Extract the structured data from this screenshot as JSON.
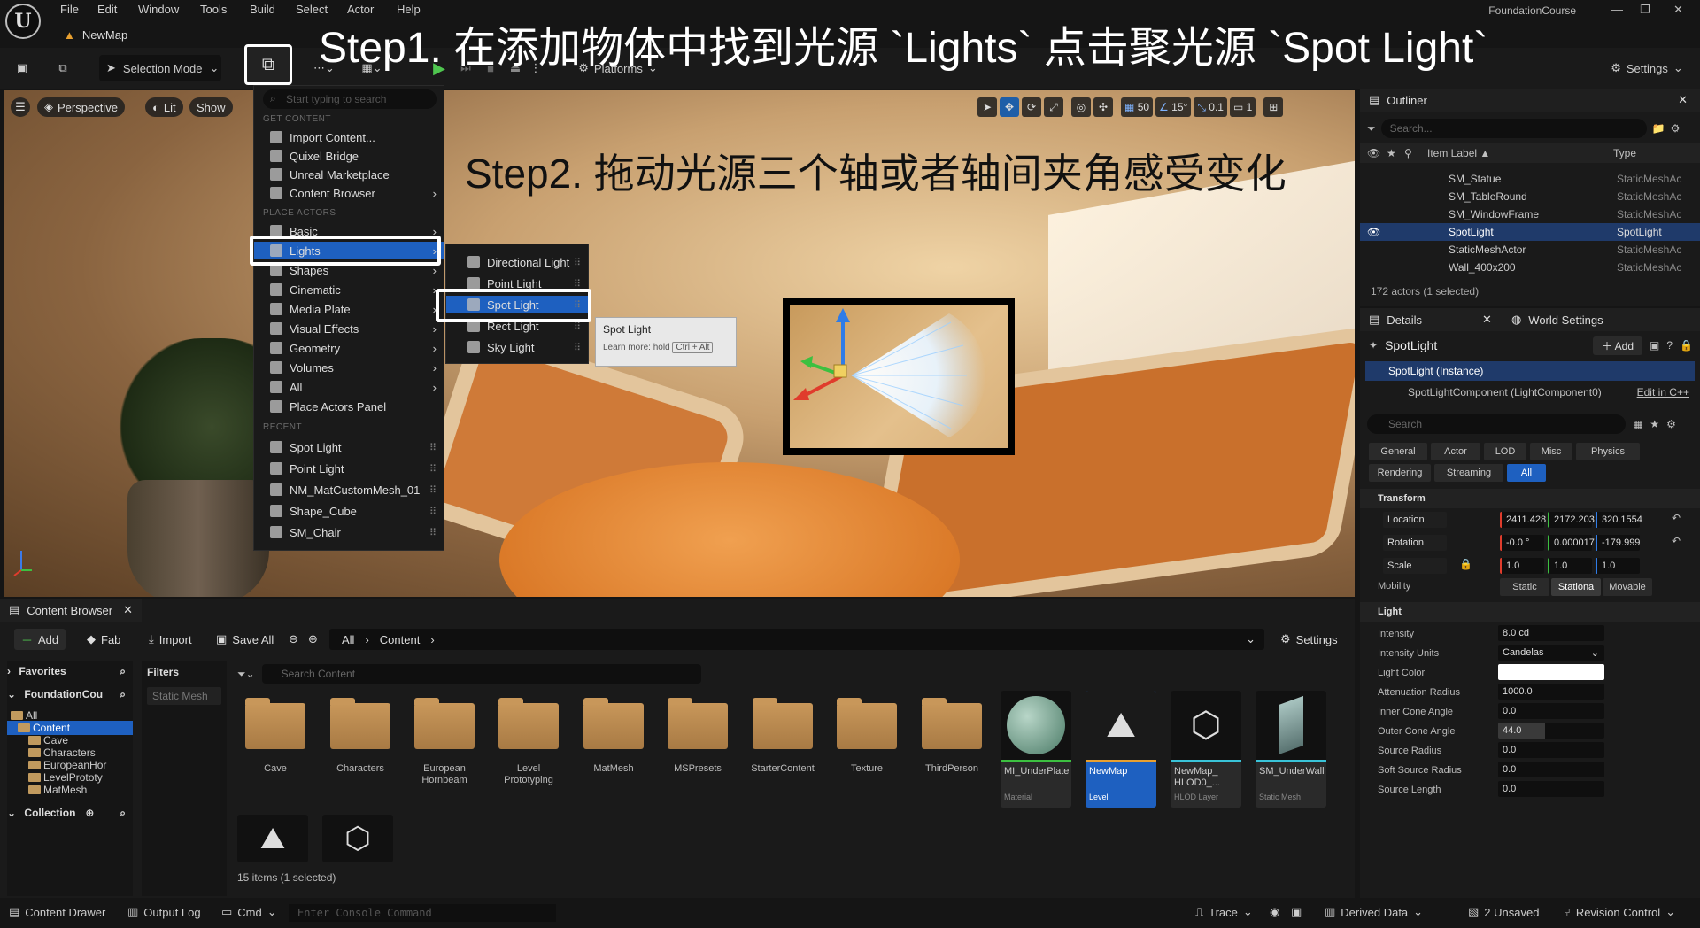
{
  "menubar": {
    "items": [
      "File",
      "Edit",
      "Window",
      "Tools",
      "Build",
      "Select",
      "Actor",
      "Help"
    ],
    "project": "FoundationCourse"
  },
  "map_tab": "NewMap",
  "toolbar": {
    "selection_mode": "Selection Mode",
    "platforms": "Platforms",
    "settings": "Settings"
  },
  "annotations": {
    "step1": "Step1. 在添加物体中找到光源 `Lights` 点击聚光源 `Spot Light`",
    "step2": "Step2. 拖动光源三个轴或者轴间夹角感受变化"
  },
  "viewport": {
    "perspective": "Perspective",
    "lit": "Lit",
    "show": "Show",
    "grid_size": "50",
    "angle": "15°",
    "scale": "0.1",
    "camera_speed": "1"
  },
  "add_menu": {
    "search_placeholder": "Start typing to search",
    "get_content_header": "GET CONTENT",
    "get_content": [
      "Import Content...",
      "Quixel Bridge",
      "Unreal Marketplace",
      "Content Browser"
    ],
    "place_actors_header": "PLACE ACTORS",
    "place_actors": [
      "Basic",
      "Lights",
      "Shapes",
      "Cinematic",
      "Media Plate",
      "Visual Effects",
      "Geometry",
      "Volumes",
      "All",
      "Place Actors Panel"
    ],
    "recent_header": "RECENT",
    "recent": [
      "Spot Light",
      "Point Light",
      "NM_MatCustomMesh_01",
      "Shape_Cube",
      "SM_Chair"
    ]
  },
  "lights_menu": [
    "Directional Light",
    "Point Light",
    "Spot Light",
    "Rect Light",
    "Sky Light"
  ],
  "tooltip": {
    "title": "Spot Light",
    "learn_more": "Learn more: hold",
    "shortcut": "Ctrl + Alt"
  },
  "outliner": {
    "title": "Outliner",
    "search_placeholder": "Search...",
    "col_label": "Item Label ▲",
    "col_type": "Type",
    "rows": [
      {
        "label": "SM_Statue",
        "type": "StaticMeshAc"
      },
      {
        "label": "SM_TableRound",
        "type": "StaticMeshAc"
      },
      {
        "label": "SM_WindowFrame",
        "type": "StaticMeshAc"
      },
      {
        "label": "SpotLight",
        "type": "SpotLight"
      },
      {
        "label": "StaticMeshActor",
        "type": "StaticMeshAc"
      },
      {
        "label": "Wall_400x200",
        "type": "StaticMeshAc"
      }
    ],
    "count": "172 actors (1 selected)"
  },
  "details": {
    "tab_details": "Details",
    "tab_world": "World Settings",
    "actor_name": "SpotLight",
    "add": "Add",
    "instance": "SpotLight (Instance)",
    "component": "SpotLightComponent (LightComponent0)",
    "edit_cpp": "Edit in C++",
    "search_placeholder": "Search",
    "filters": [
      "General",
      "Actor",
      "LOD",
      "Misc",
      "Physics",
      "Rendering",
      "Streaming",
      "All"
    ],
    "transform_header": "Transform",
    "location_label": "Location",
    "location": [
      "2411.428",
      "2172.203",
      "320.1554"
    ],
    "rotation_label": "Rotation",
    "rotation": [
      "-0.0 °",
      "0.000017",
      "-179.999"
    ],
    "scale_label": "Scale",
    "scale": [
      "1.0",
      "1.0",
      "1.0"
    ],
    "mobility_label": "Mobility",
    "mobility": [
      "Static",
      "Stationa",
      "Movable"
    ],
    "light_header": "Light",
    "light_props": [
      {
        "label": "Intensity",
        "value": "8.0 cd"
      },
      {
        "label": "Intensity Units",
        "value": "Candelas"
      },
      {
        "label": "Light Color",
        "value": ""
      },
      {
        "label": "Attenuation Radius",
        "value": "1000.0"
      },
      {
        "label": "Inner Cone Angle",
        "value": "0.0"
      },
      {
        "label": "Outer Cone Angle",
        "value": "44.0"
      },
      {
        "label": "Source Radius",
        "value": "0.0"
      },
      {
        "label": "Soft Source Radius",
        "value": "0.0"
      },
      {
        "label": "Source Length",
        "value": "0.0"
      }
    ]
  },
  "content_browser": {
    "title": "Content Browser",
    "add": "Add",
    "fab": "Fab",
    "import": "Import",
    "save_all": "Save All",
    "path": [
      "All",
      "Content"
    ],
    "settings": "Settings",
    "favorites": "Favorites",
    "foundation": "FoundationCou",
    "tree": [
      "All",
      "Content",
      "Cave",
      "Characters",
      "EuropeanHor",
      "LevelPrototy",
      "MatMesh"
    ],
    "collection": "Collection",
    "filters_label": "Filters",
    "filter_chip": "Static Mesh",
    "search_placeholder": "Search Content",
    "folders": [
      "Cave",
      "Characters",
      "European Hornbeam",
      "Level Prototyping",
      "MatMesh",
      "MSPresets",
      "StarterContent",
      "Texture",
      "ThirdPerson"
    ],
    "assets": [
      {
        "name": "MI_UnderPlate",
        "type": "Material"
      },
      {
        "name": "NewMap",
        "type": "Level"
      },
      {
        "name": "NewMap_ HLOD0_...",
        "type": "HLOD Layer"
      },
      {
        "name": "SM_UnderWall",
        "type": "Static Mesh"
      }
    ],
    "items_count": "15 items (1 selected)"
  },
  "statusbar": {
    "content_drawer": "Content Drawer",
    "output_log": "Output Log",
    "cmd": "Cmd",
    "console_placeholder": "Enter Console Command",
    "trace": "Trace",
    "derived_data": "Derived Data",
    "unsaved": "2 Unsaved",
    "revision": "Revision Control"
  },
  "colors": {
    "accent": "#1e60c0",
    "folder": "#c8975a",
    "x_axis": "#e03c2c",
    "y_axis": "#3cc040",
    "z_axis": "#2f7ce8"
  }
}
